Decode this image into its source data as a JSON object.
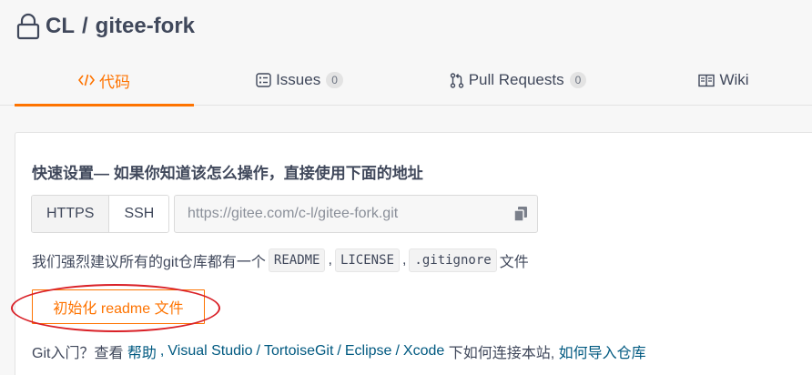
{
  "repo": {
    "owner": "CL",
    "separator": "/",
    "name": "gitee-fork"
  },
  "tabs": [
    {
      "label": "代码",
      "icon": "code-icon",
      "active": true
    },
    {
      "label": "Issues",
      "icon": "issues-icon",
      "count": "0"
    },
    {
      "label": "Pull Requests",
      "icon": "pull-request-icon",
      "count": "0"
    },
    {
      "label": "Wiki",
      "icon": "wiki-book-icon"
    }
  ],
  "setup": {
    "title": "快速设置— 如果你知道该怎么操作，直接使用下面的地址",
    "protocols": [
      "HTTPS",
      "SSH"
    ],
    "clone_url": "https://gitee.com/c-l/gitee-fork.git",
    "recommend_prefix": "我们强烈建议所有的git仓库都有一个",
    "files": [
      "README",
      "LICENSE",
      ".gitignore"
    ],
    "comma": ",",
    "recommend_suffix": "文件",
    "init_button": "初始化 readme 文件"
  },
  "help": {
    "prefix": "Git入门？查看",
    "help_link": "帮助",
    "tools": [
      "Visual Studio",
      "TortoiseGit",
      "Eclipse",
      "Xcode"
    ],
    "comma": ",",
    "slash": "/",
    "middle": "下如何连接本站,",
    "import_link": "如何导入仓库"
  },
  "colors": {
    "accent": "#fe7300",
    "link": "#005980",
    "highlight": "#d92027"
  }
}
